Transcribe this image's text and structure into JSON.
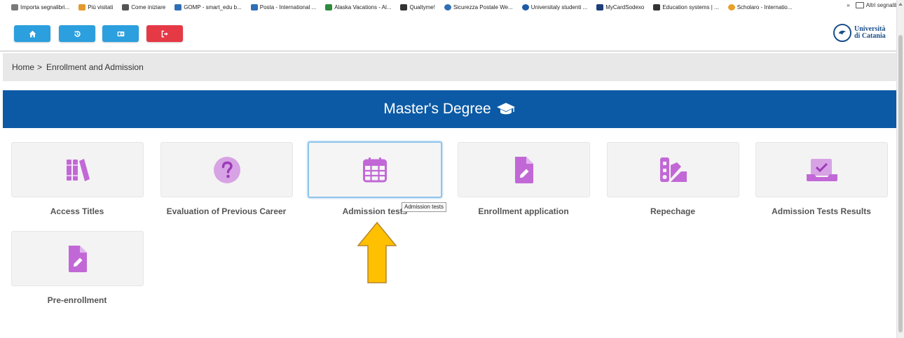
{
  "bookmarks": {
    "items": [
      {
        "label": "Importa segnalibri...",
        "color": "#7a7a7a"
      },
      {
        "label": "Più visitati",
        "color": "#e39a2e"
      },
      {
        "label": "Come iniziare",
        "color": "#555555"
      },
      {
        "label": "GOMP - smart_edu b...",
        "color": "#2f6fb5"
      },
      {
        "label": "Posta - International ...",
        "color": "#2f6fb5"
      },
      {
        "label": "Alaska Vacations - Al...",
        "color": "#2e8b3c"
      },
      {
        "label": "Qualtyme!",
        "color": "#333333"
      },
      {
        "label": "Sicurezza Postale We...",
        "color": "#2f6fb5"
      },
      {
        "label": "Universitaly studenti ...",
        "color": "#1e5aa8"
      },
      {
        "label": "MyCardSodexo",
        "color": "#1e3e7a"
      },
      {
        "label": "Education systems | ...",
        "color": "#333333"
      },
      {
        "label": "Scholaro - Internatio...",
        "color": "#e8a02a"
      }
    ],
    "overflow": "»",
    "other_bookmarks": "Altri segnalibri"
  },
  "toolbar": {
    "buttons": [
      {
        "name": "home",
        "icon": "home-icon",
        "color": "#2c9fde"
      },
      {
        "name": "history",
        "icon": "history-icon",
        "color": "#2c9fde"
      },
      {
        "name": "id-card",
        "icon": "id-card-icon",
        "color": "#2c9fde"
      },
      {
        "name": "logout",
        "icon": "logout-icon",
        "color": "#e53946"
      }
    ],
    "logo": {
      "line1": "Università",
      "line2": "di Catania"
    }
  },
  "breadcrumb": {
    "home": "Home",
    "separator": ">",
    "current": "Enrollment and Admission"
  },
  "banner": {
    "title": "Master's Degree",
    "icon": "graduation-cap-icon",
    "color": "#0c5aa5"
  },
  "tiles": [
    {
      "label": "Access Titles",
      "icon": "books-icon"
    },
    {
      "label": "Evaluation of Previous Career",
      "icon": "question-circle-icon"
    },
    {
      "label": "Admission tests",
      "icon": "calendar-icon",
      "active": true
    },
    {
      "label": "Enrollment application",
      "icon": "file-edit-icon"
    },
    {
      "label": "Repechage",
      "icon": "swatchbook-icon"
    },
    {
      "label": "Admission Tests Results",
      "icon": "inbox-check-icon"
    },
    {
      "label": "Pre-enrollment",
      "icon": "file-edit-icon"
    }
  ],
  "tooltip": "Admission tests",
  "colors": {
    "icon_purple": "#c268d6",
    "arrow_fill": "#ffc000",
    "arrow_stroke": "#b7862a"
  }
}
